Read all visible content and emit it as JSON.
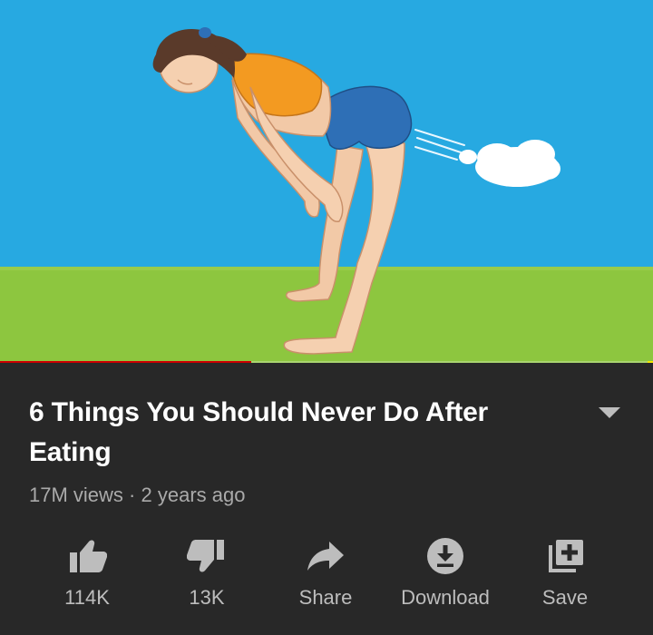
{
  "video": {
    "thumbnail_icon": "woman-bending-over-illustration",
    "progress_fraction": 0.385,
    "progress_color": "#cc0000"
  },
  "details": {
    "title": "6 Things You Should Never Do After Eating",
    "views": "17M views",
    "separator": "·",
    "age": "2 years ago",
    "expand_icon": "chevron-down-icon"
  },
  "actions": [
    {
      "icon": "thumbs-up-icon",
      "label": "114K"
    },
    {
      "icon": "thumbs-down-icon",
      "label": "13K"
    },
    {
      "icon": "share-icon",
      "label": "Share"
    },
    {
      "icon": "download-icon",
      "label": "Download"
    },
    {
      "icon": "save-to-playlist-icon",
      "label": "Save"
    }
  ],
  "colors": {
    "background": "#282828",
    "title": "#ffffff",
    "meta": "#aaaaaa",
    "icon": "#bdbdbd",
    "sky": "#27a9e1",
    "grass": "#8dc63f"
  }
}
